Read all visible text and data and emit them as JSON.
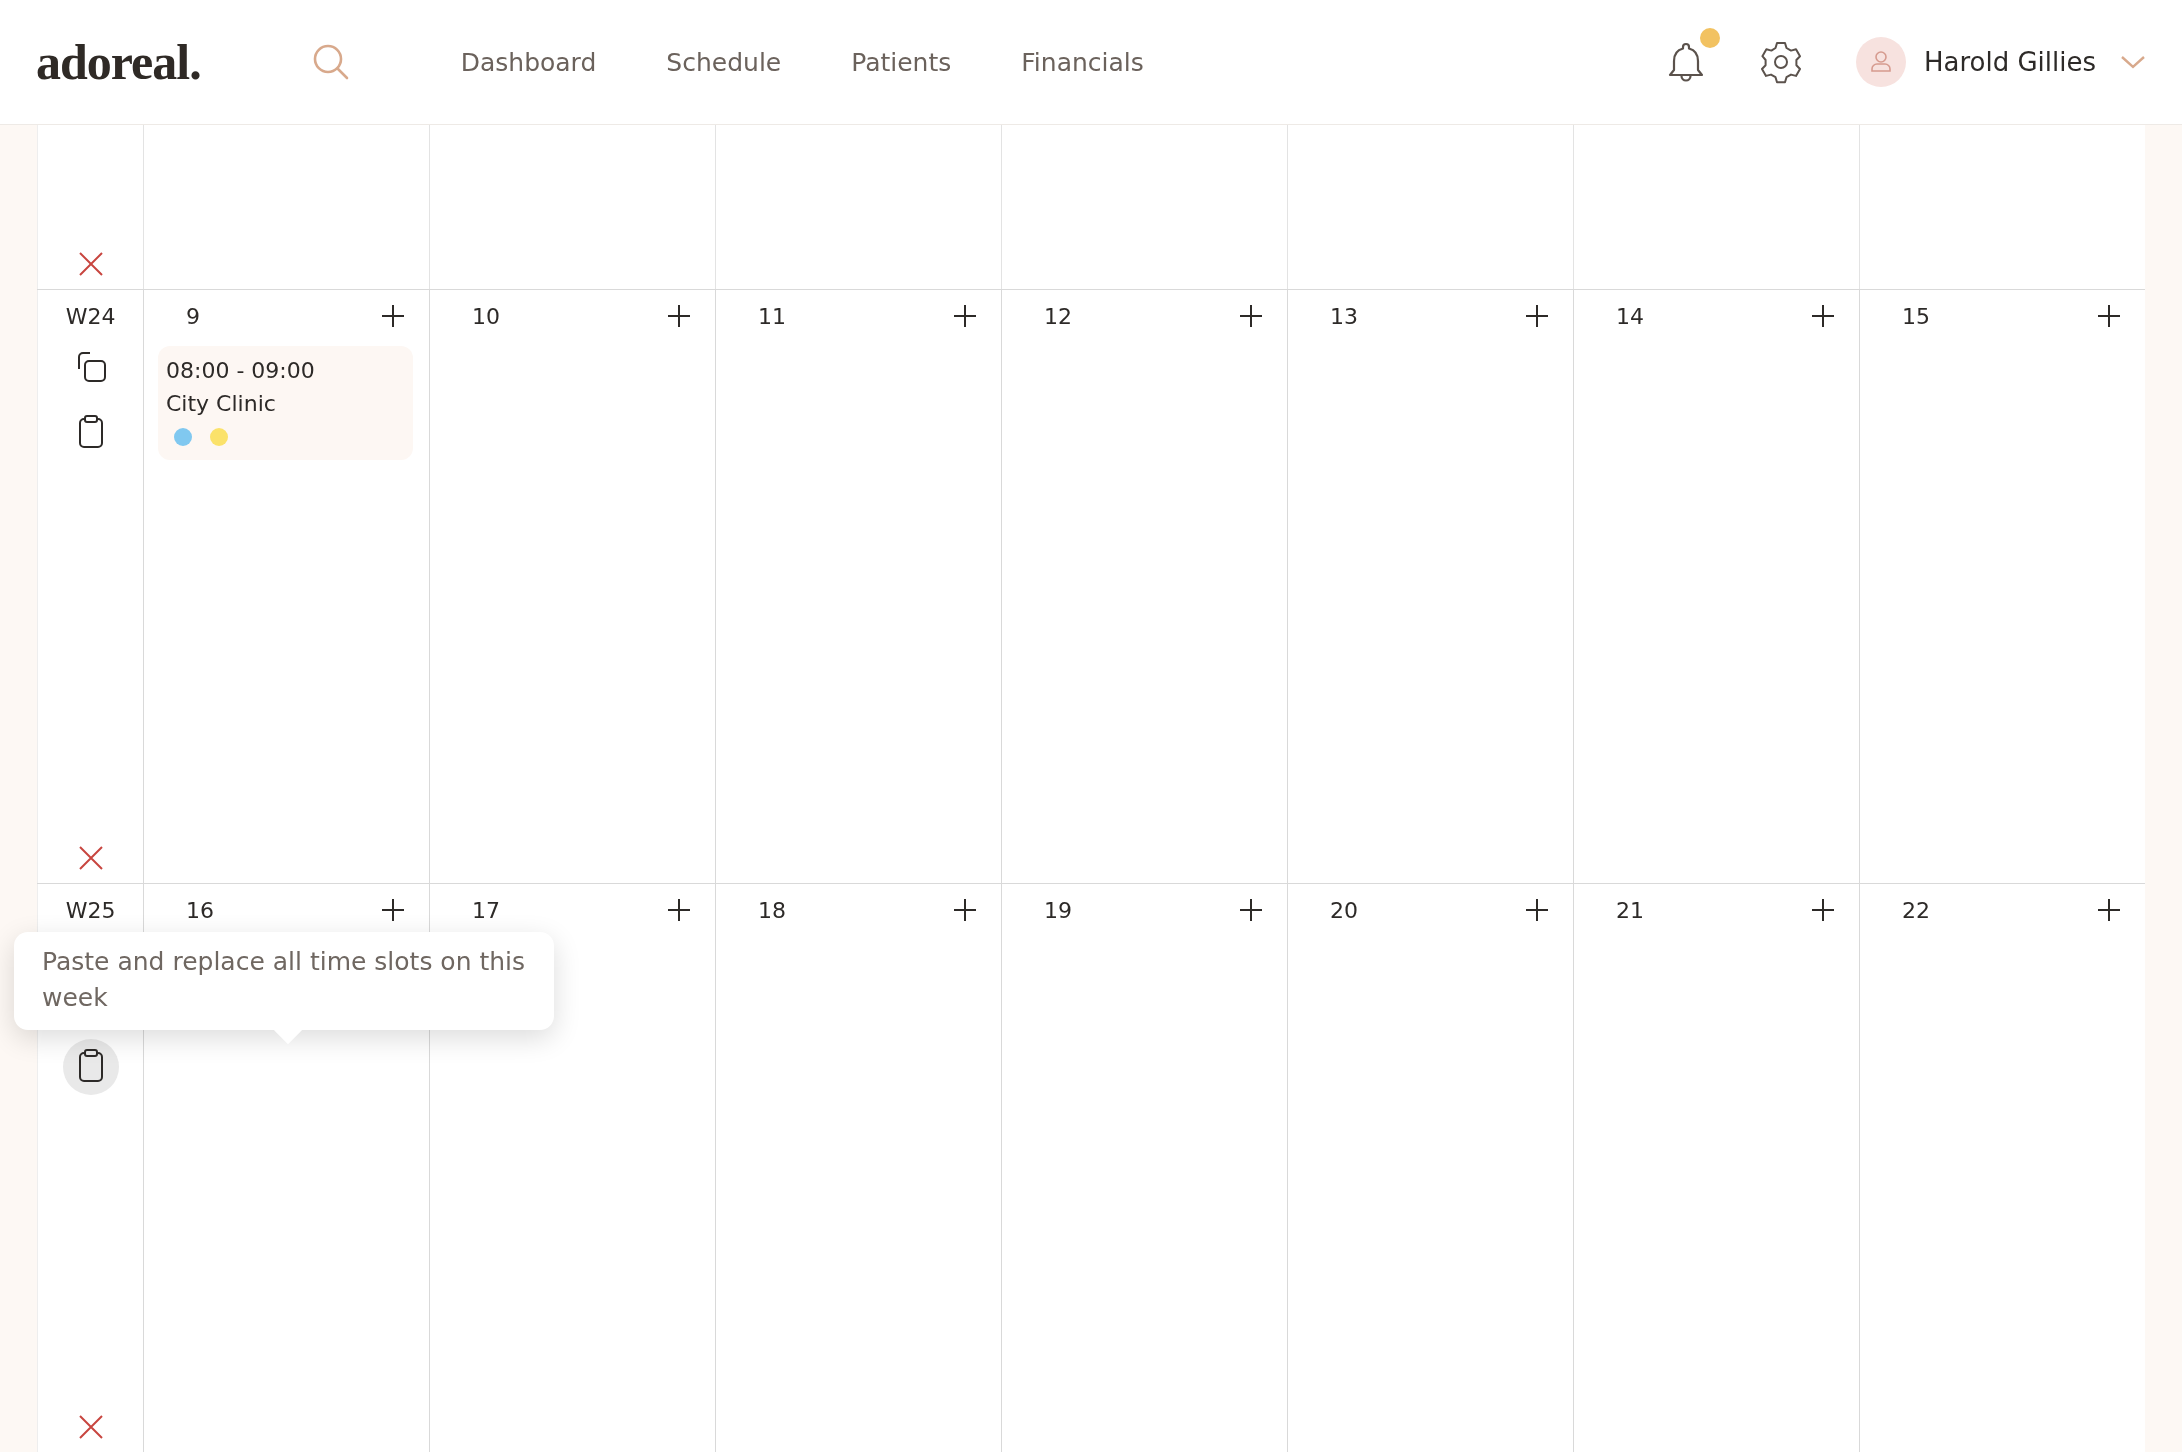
{
  "header": {
    "logo": "adoreal.",
    "nav": [
      {
        "label": "Dashboard",
        "selected": false
      },
      {
        "label": "Schedule",
        "selected": false
      },
      {
        "label": "Patients",
        "selected": false
      },
      {
        "label": "Financials",
        "selected": false
      }
    ],
    "notifications": {
      "unread": true
    },
    "user": {
      "name": "Harold Gillies"
    }
  },
  "calendar": {
    "weeks": [
      {
        "label": "W24",
        "paste_hovered": false,
        "days": [
          {
            "number": "9",
            "events": [
              {
                "time": "08:00 - 09:00",
                "place": "City Clinic",
                "tags": [
                  {
                    "color": "#80c8f0"
                  },
                  {
                    "color": "#fbe26a"
                  }
                ]
              }
            ]
          },
          {
            "number": "10"
          },
          {
            "number": "11"
          },
          {
            "number": "12"
          },
          {
            "number": "13"
          },
          {
            "number": "14"
          },
          {
            "number": "15"
          }
        ]
      },
      {
        "label": "W25",
        "paste_hovered": true,
        "tooltip": "Paste and replace all time slots on this week",
        "days": [
          {
            "number": "16"
          },
          {
            "number": "17"
          },
          {
            "number": "18"
          },
          {
            "number": "19"
          },
          {
            "number": "20"
          },
          {
            "number": "21"
          },
          {
            "number": "22"
          }
        ]
      }
    ]
  }
}
